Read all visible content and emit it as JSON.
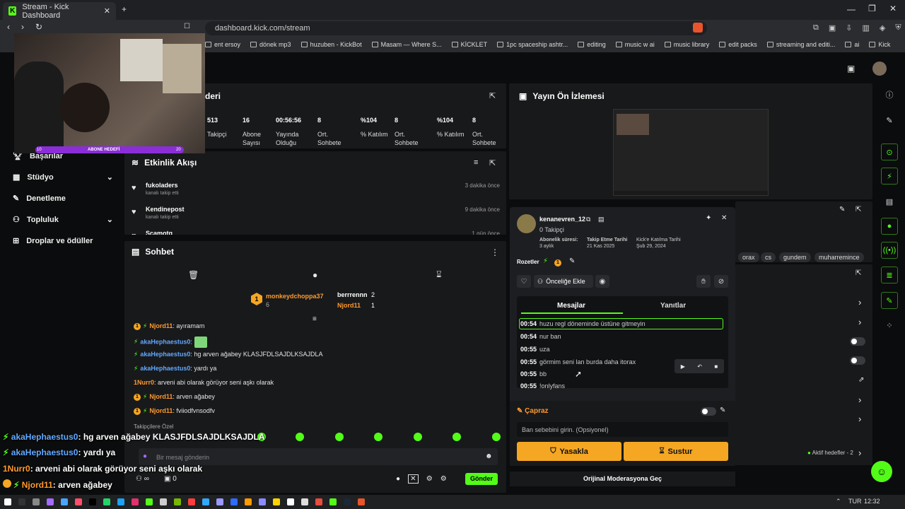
{
  "browser": {
    "tab_title": "Stream - Kick Dashboard",
    "url": "dashboard.kick.com/stream",
    "bookmarks": [
      "ent ersoy",
      "dönek mp3",
      "huzuben - KickBot",
      "Masam — Where S...",
      "KİCKLET",
      "1pc spaceship ashtr...",
      "editing",
      "music w ai",
      "music library",
      "edit packs",
      "streaming and editi...",
      "ai",
      "Kick"
    ]
  },
  "webcam": {
    "bar_text": "ABONE HEDEFİ",
    "left_num": "10",
    "right_num": "20"
  },
  "nav": {
    "items": [
      "Başarılar",
      "Stüdyo",
      "Denetleme",
      "Topluluk",
      "Droplar ve ödüller"
    ]
  },
  "stats_panel": {
    "title_fragment": "deri",
    "stats": [
      {
        "value": "513",
        "label": "Takipçi"
      },
      {
        "value": "16",
        "label": "Abone Sayısı"
      },
      {
        "value": "00:56:56",
        "label": "Yayında Olduğu"
      },
      {
        "value": "8",
        "label": "Ort. Sohbete"
      },
      {
        "value": "%104",
        "label": "% Katılım"
      },
      {
        "value": "8",
        "label": "Ort. Sohbete"
      },
      {
        "value": "%104",
        "label": "% Katılım"
      },
      {
        "value": "8",
        "label": "Ort. Sohbete"
      }
    ]
  },
  "activity": {
    "title": "Etkinlik Akışı",
    "events": [
      {
        "user": "fukoladers",
        "action": "kanalı takip etti",
        "time": "3 dakika önce"
      },
      {
        "user": "Kendinepost",
        "action": "kanalı takip etti",
        "time": "9 dakika önce"
      },
      {
        "user": "Scamotg",
        "action": "",
        "time": "1 gün önce"
      }
    ]
  },
  "chat": {
    "title": "Sohbet",
    "leaderboard": {
      "first": {
        "name": "monkeydchoppa37",
        "count": "6"
      },
      "second": {
        "name": "berrrennn",
        "count": "2"
      },
      "third": {
        "name": "Njord11",
        "count": "1"
      }
    },
    "messages": [
      {
        "user": "Njord11",
        "text": ": ayıramam"
      },
      {
        "user": "akaHephaestus0",
        "text": ":"
      },
      {
        "user": "akaHephaestus0",
        "text": ": hg arven ağabey KLASJFDLSAJDLKSAJDLA"
      },
      {
        "user": "akaHephaestus0",
        "text": ": yardı ya"
      },
      {
        "user": "1Nurr0",
        "text": ": arveni abi olarak görüyor seni aşkı olarak"
      },
      {
        "user": "Njord11",
        "text": ": arven ağabey"
      },
      {
        "user": "Njord11",
        "text": ": fviiodfvnsodfv"
      }
    ],
    "followers_only": "Takipçilere Özel",
    "input_placeholder": "Bir mesaj gönderin",
    "send_label": "Gönder",
    "infinity": "∞",
    "zero": "0"
  },
  "overlay_chat": [
    {
      "user": "akaHephaestus0",
      "text": ": hg arven ağabey KLASJFDLSAJDLKSAJDLA"
    },
    {
      "user": "akaHephaestus0",
      "text": ": yardı ya"
    },
    {
      "user": "1Nurr0",
      "text": ": arveni abi olarak görüyor seni aşkı olarak"
    },
    {
      "user": "Njord11",
      "text": ": arven ağabey"
    },
    {
      "user": "",
      "text": "fviiodfvnsodfv"
    }
  ],
  "preview": {
    "title": "Yayın Ön İzlemesi"
  },
  "usercard": {
    "username": "kenanevren_12",
    "followers": "0 Takipçi",
    "sub_label": "Abonelik süresi:",
    "sub_value": "3 aylık",
    "follow_label": "Takip Etme Tarihi",
    "follow_value": "21 Kas 2025",
    "join_label": "Kick'e Katılma Tarihi",
    "join_value": "Şub 29, 2024",
    "badges_label": "Rozetler",
    "badge_num": "1",
    "priority_label": "Önceliğe Ekle",
    "tab_messages": "Mesajlar",
    "tab_replies": "Yanıtlar",
    "messages": [
      {
        "time": "00:54",
        "text": "huzu regl döneminde üstüne gitmeyin"
      },
      {
        "time": "00:54",
        "text": "nur ban"
      },
      {
        "time": "00:55",
        "text": "uza"
      },
      {
        "time": "00:55",
        "text": "görmim seni lan burda daha itorax"
      },
      {
        "time": "00:55",
        "text": "bb"
      },
      {
        "time": "00:55",
        "text": "!onlyfans"
      }
    ],
    "section_label": "Çapraz",
    "ban_placeholder": "Ban sebebini girin. (Opsiyonel)",
    "ban_label": "Yasakla",
    "mute_label": "Sustur",
    "orig_mod_label": "Orijinal Moderasyona Geç"
  },
  "right_panel": {
    "tags": [
      "orax",
      "cs",
      "gundem",
      "muharremince"
    ],
    "active_goals": "Aktif hedefler - 2"
  },
  "taskbar": {
    "lang": "TUR",
    "time": "12:32"
  }
}
